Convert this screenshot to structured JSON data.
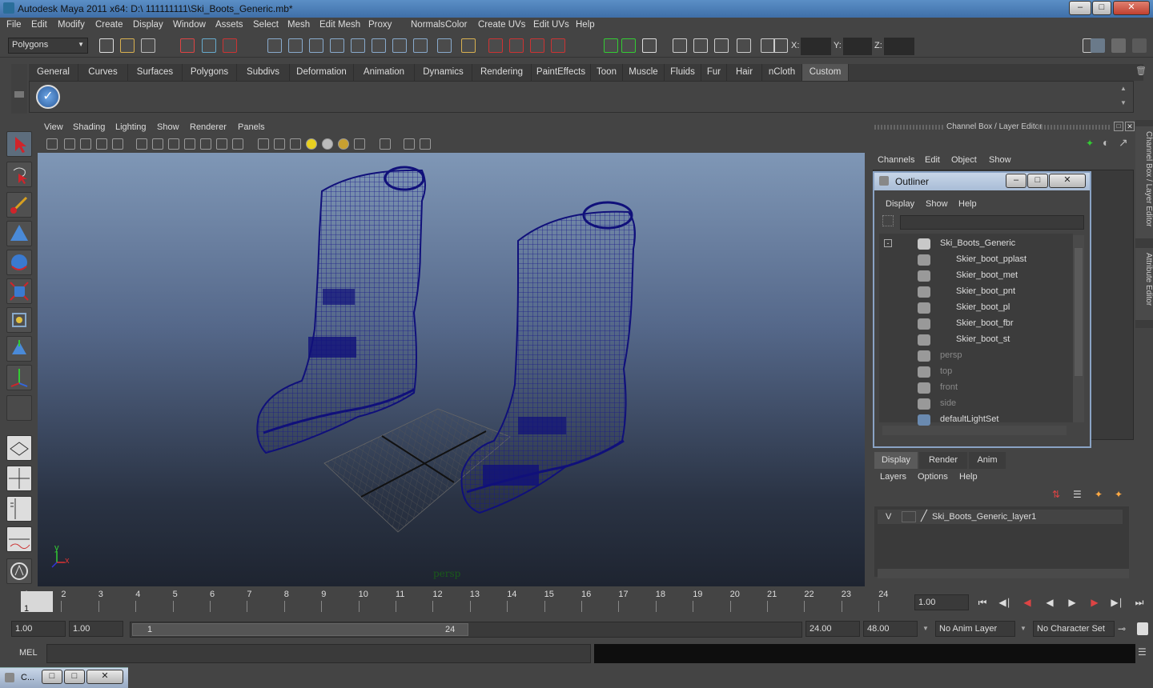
{
  "window": {
    "title": "Autodesk Maya 2011 x64: D:\\ 111111111\\Ski_Boots_Generic.mb*"
  },
  "menus": [
    "File",
    "Edit",
    "Modify",
    "Create",
    "Display",
    "Window",
    "Assets",
    "Select",
    "Mesh",
    "Edit Mesh",
    "Proxy",
    "Normals",
    "Color",
    "Create UVs",
    "Edit UVs",
    "Help"
  ],
  "toolbar": {
    "mode_select": "Polygons",
    "x_label": "X:",
    "y_label": "Y:",
    "z_label": "Z:"
  },
  "shelf_tabs": [
    "General",
    "Curves",
    "Surfaces",
    "Polygons",
    "Subdivs",
    "Deformation",
    "Animation",
    "Dynamics",
    "Rendering",
    "PaintEffects",
    "Toon",
    "Muscle",
    "Fluids",
    "Fur",
    "Hair",
    "nCloth",
    "Custom"
  ],
  "shelf_active_tab": "Custom",
  "viewport": {
    "menu": [
      "View",
      "Shading",
      "Lighting",
      "Show",
      "Renderer",
      "Panels"
    ],
    "camera_label": "persp",
    "axis_y": "y",
    "axis_x": "x"
  },
  "channel_box": {
    "title": "Channel Box / Layer Editor",
    "menu": [
      "Channels",
      "Edit",
      "Object",
      "Show"
    ],
    "side_tabs": [
      "Channel Box / Layer Editor",
      "Attribute Editor"
    ]
  },
  "outliner": {
    "title": "Outliner",
    "menu": [
      "Display",
      "Show",
      "Help"
    ],
    "items": [
      {
        "label": "Ski_Boots_Generic",
        "dim": false
      },
      {
        "label": "Skier_boot_pplast",
        "dim": false
      },
      {
        "label": "Skier_boot_met",
        "dim": false
      },
      {
        "label": "Skier_boot_pnt",
        "dim": false
      },
      {
        "label": "Skier_boot_pl",
        "dim": false
      },
      {
        "label": "Skier_boot_fbr",
        "dim": false
      },
      {
        "label": "Skier_boot_st",
        "dim": false
      },
      {
        "label": "persp",
        "dim": true
      },
      {
        "label": "top",
        "dim": true
      },
      {
        "label": "front",
        "dim": true
      },
      {
        "label": "side",
        "dim": true
      },
      {
        "label": "defaultLightSet",
        "dim": false
      }
    ]
  },
  "layer_editor": {
    "tabs": [
      "Display",
      "Render",
      "Anim"
    ],
    "menu": [
      "Layers",
      "Options",
      "Help"
    ],
    "layer": {
      "visible": "V",
      "name": "Ski_Boots_Generic_layer1"
    }
  },
  "timeline": {
    "ticks": [
      "1",
      "2",
      "3",
      "4",
      "5",
      "6",
      "7",
      "8",
      "9",
      "10",
      "11",
      "12",
      "13",
      "14",
      "15",
      "16",
      "17",
      "18",
      "19",
      "20",
      "21",
      "22",
      "23",
      "24"
    ],
    "current_frame": "1",
    "current_time": "1.00"
  },
  "range": {
    "start": "1.00",
    "start2": "1.00",
    "slider_start": "1",
    "slider_end": "24",
    "end": "24.00",
    "end2": "48.00",
    "anim_layer": "No Anim Layer",
    "char_set": "No Character Set"
  },
  "cmdline": {
    "label": "MEL"
  },
  "taskbar": {
    "item": "C..."
  }
}
